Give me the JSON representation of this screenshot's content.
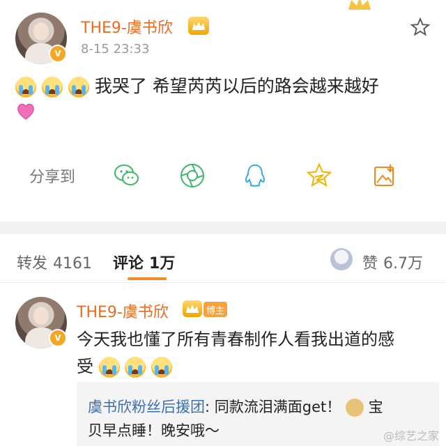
{
  "post": {
    "author": "THE9-虞书欣",
    "time": "8-15 23:33",
    "line1": "我哭了  希望芮芮以后的路会越来越好",
    "share_label": "分享到",
    "share_icons": [
      "wechat-icon",
      "moments-icon",
      "qq-icon",
      "qzone-icon",
      "save-image-icon"
    ]
  },
  "tabs": {
    "repost_label": "转发",
    "repost_count": "4161",
    "comment_label": "评论",
    "comment_count": "1万",
    "like_label": "赞",
    "like_count": "6.7万"
  },
  "comment": {
    "author": "THE9-虞书欣",
    "badge": "博主",
    "line1": "今天我也懂了所有青春制作人看我出道的感",
    "line2": "受",
    "reply_author": "虞书欣粉丝后援团",
    "reply_line1": ": 同款流泪满面get！",
    "reply_line1_tail": "宝",
    "reply_line2": "贝早点睡！晚安哦～"
  },
  "watermark": "@综艺之家",
  "colors": {
    "name": "#e86b1f",
    "accent": "#f28c28",
    "reply_author": "#3a6fb0"
  }
}
